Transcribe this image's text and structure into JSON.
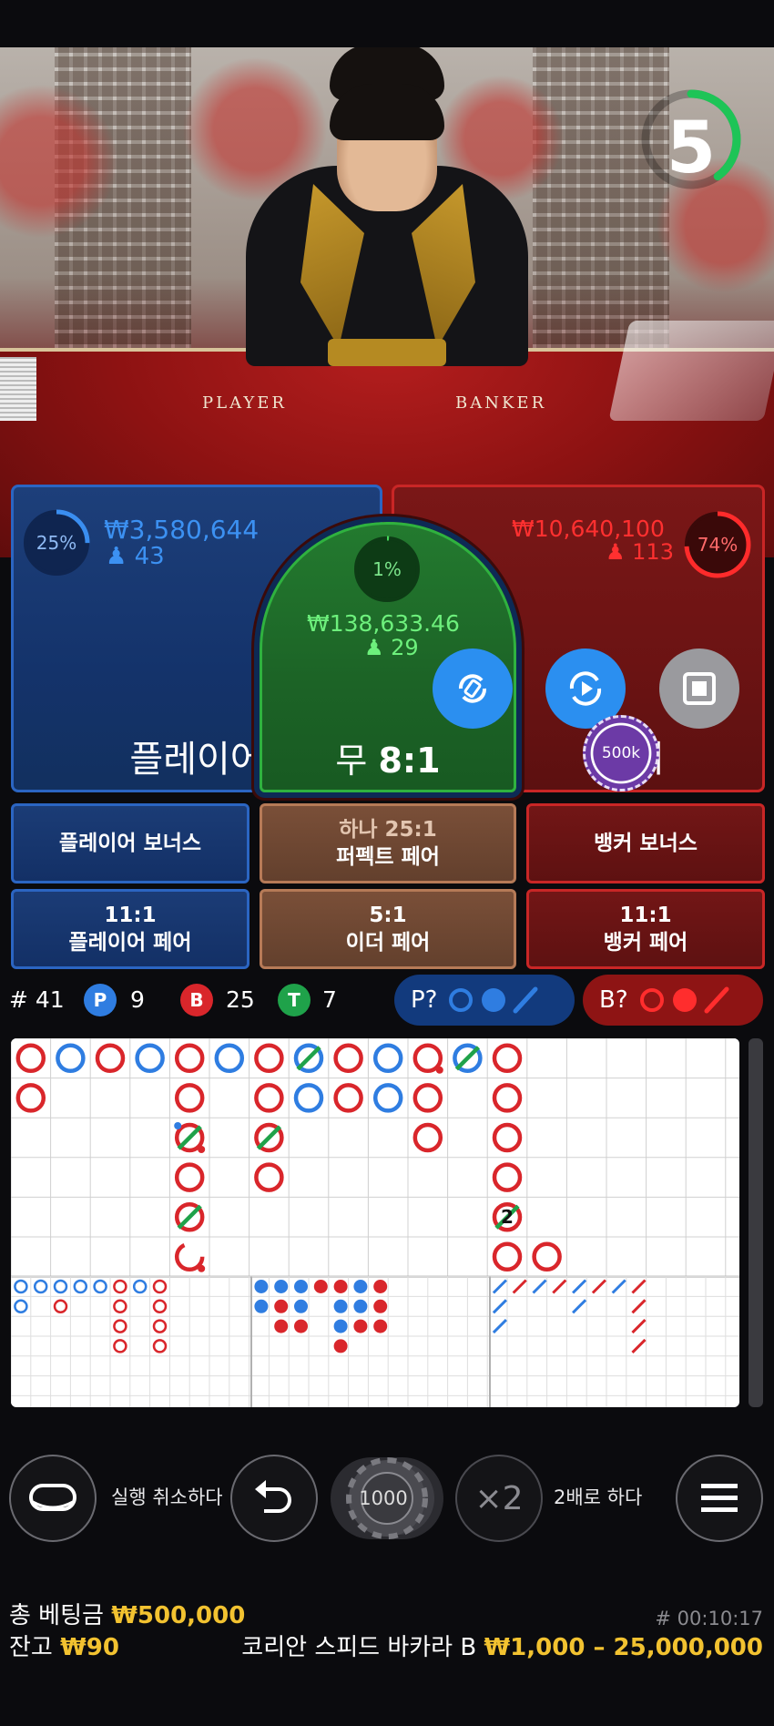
{
  "timer": {
    "seconds": "5",
    "fraction": 0.4
  },
  "table_text": {
    "player": "PLAYER",
    "banker": "BANKER"
  },
  "player": {
    "pct": "25%",
    "pct_value": 0.25,
    "amount": "₩3,580,644",
    "count": "43",
    "label": "플레이어"
  },
  "tie": {
    "pct": "1%",
    "pct_value": 0.01,
    "amount": "₩138,633.46",
    "count": "29",
    "label_prefix": "무",
    "label_odds": "8:1"
  },
  "banker": {
    "pct": "74%",
    "pct_value": 0.74,
    "amount": "₩10,640,100",
    "count": "113",
    "label": "뱅커"
  },
  "chip_on_table": "500k",
  "side_bets": {
    "player_bonus": "플레이어 보너스",
    "perfect_pair_top": "하나 25:1",
    "perfect_pair": "퍼펙트 페어",
    "banker_bonus": "뱅커 보너스",
    "player_pair_odds": "11:1",
    "player_pair": "플레이어 페어",
    "either_pair_odds": "5:1",
    "either_pair": "이더 페어",
    "banker_pair_odds": "11:1",
    "banker_pair": "뱅커 페어"
  },
  "stats": {
    "round_label": "# 41",
    "player_letter": "P",
    "player_count": "9",
    "banker_letter": "B",
    "banker_count": "25",
    "tie_letter": "T",
    "tie_count": "7"
  },
  "predict": {
    "player": "P?",
    "banker": "B?"
  },
  "colors": {
    "player": "#2f7de1",
    "banker": "#d9262b",
    "tie": "#1fa24a",
    "gold": "#f2c230"
  },
  "road": {
    "big_road": [
      [
        {
          "c": "B"
        },
        {
          "c": "B"
        }
      ],
      [
        {
          "c": "P"
        }
      ],
      [
        {
          "c": "B"
        }
      ],
      [
        {
          "c": "P"
        }
      ],
      [
        {
          "c": "B"
        },
        {
          "c": "B"
        },
        {
          "c": "B",
          "tie": true,
          "pp": true,
          "bp": true
        },
        {
          "c": "B"
        },
        {
          "c": "B",
          "tie": true
        },
        {
          "c": "B",
          "bp": true,
          "partial": true
        }
      ],
      [
        {
          "c": "P"
        }
      ],
      [
        {
          "c": "B"
        },
        {
          "c": "B"
        },
        {
          "c": "B",
          "tie": true
        },
        {
          "c": "B"
        }
      ],
      [
        {
          "c": "P",
          "tie": true
        },
        {
          "c": "P"
        }
      ],
      [
        {
          "c": "B"
        },
        {
          "c": "B"
        }
      ],
      [
        {
          "c": "P"
        },
        {
          "c": "P"
        }
      ],
      [
        {
          "c": "B",
          "bp": true
        },
        {
          "c": "B"
        },
        {
          "c": "B"
        }
      ],
      [
        {
          "c": "P",
          "tie": true
        }
      ],
      [
        {
          "c": "B"
        },
        {
          "c": "B"
        },
        {
          "c": "B"
        },
        {
          "c": "B"
        },
        {
          "c": "B",
          "tie": true,
          "label": "2"
        },
        {
          "c": "B"
        }
      ],
      [
        {
          "c": "B",
          "row": 5
        }
      ]
    ],
    "big_eye": [
      [
        "P",
        "P"
      ],
      [
        "P"
      ],
      [
        "P",
        "B"
      ],
      [
        "P"
      ],
      [
        "P"
      ],
      [
        "B",
        "B",
        "B",
        "B"
      ],
      [
        "P"
      ],
      [
        "B",
        "B",
        "B",
        "B"
      ]
    ],
    "small": [
      [
        "P",
        "P"
      ],
      [
        "P",
        "B",
        "B"
      ],
      [
        "P",
        "P",
        "B"
      ],
      [
        "B"
      ],
      [
        "B",
        "P",
        "P",
        "B"
      ],
      [
        "P",
        "P",
        "B"
      ],
      [
        "B",
        "B",
        "B"
      ]
    ],
    "cockroach": [
      [
        "P",
        "P",
        "P"
      ],
      [
        "B"
      ],
      [
        "P"
      ],
      [
        "B"
      ],
      [
        "P",
        "P"
      ],
      [
        "B"
      ],
      [
        "P"
      ],
      [
        "B",
        "B",
        "B",
        "B"
      ]
    ]
  },
  "controls": {
    "undo_label": "실행 취소하다",
    "chip_value": "1000",
    "double_symbol": "×2",
    "double_label": "2배로 하다"
  },
  "footer": {
    "total_bet_label": "총 베팅금",
    "total_bet_value": "₩500,000",
    "game_id": "# 00:10:17",
    "balance_label": "잔고",
    "balance_value": "₩90",
    "table_name": "코리안 스피드 바카라 B",
    "limits": "₩1,000 – 25,000,000"
  }
}
